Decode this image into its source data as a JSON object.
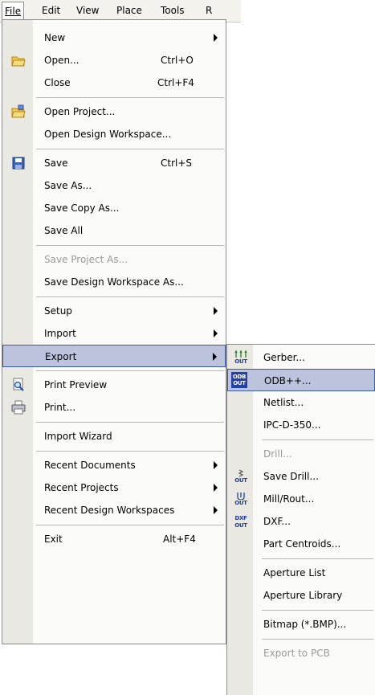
{
  "menubar": {
    "file": "File",
    "edit": "Edit",
    "view": "View",
    "place": "Place",
    "tools": "Tools",
    "reports": "R"
  },
  "file_menu": {
    "new": "New",
    "open": "Open...",
    "open_shortcut": "Ctrl+O",
    "close": "Close",
    "close_shortcut": "Ctrl+F4",
    "open_project": "Open Project...",
    "open_workspace": "Open Design Workspace...",
    "save": "Save",
    "save_shortcut": "Ctrl+S",
    "save_as": "Save As...",
    "save_copy_as": "Save Copy As...",
    "save_all": "Save All",
    "save_project_as": "Save Project As...",
    "save_workspace_as": "Save Design Workspace As...",
    "setup": "Setup",
    "import": "Import",
    "export": "Export",
    "print_preview": "Print Preview",
    "print": "Print...",
    "import_wizard": "Import Wizard",
    "recent_documents": "Recent Documents",
    "recent_projects": "Recent Projects",
    "recent_workspaces": "Recent Design Workspaces",
    "exit": "Exit",
    "exit_shortcut": "Alt+F4"
  },
  "export_menu": {
    "gerber": "Gerber...",
    "odb": "ODB++...",
    "netlist": "Netlist...",
    "ipc": "IPC-D-350...",
    "drill": "Drill...",
    "save_drill": "Save Drill...",
    "mill_rout": "Mill/Rout...",
    "dxf": "DXF...",
    "part_centroids": "Part Centroids...",
    "aperture_list": "Aperture List",
    "aperture_library": "Aperture Library",
    "bitmap": "Bitmap (*.BMP)...",
    "export_to_pcb": "Export to PCB"
  },
  "icon_badges": {
    "out": "OUT",
    "odb": "ODB",
    "dxf": "DXF"
  },
  "colors": {
    "highlight": "#bcc4dd",
    "highlight_border": "#3c5a9c",
    "gutter": "#e9e8e2",
    "disabled_text": "#9a9a9a"
  }
}
